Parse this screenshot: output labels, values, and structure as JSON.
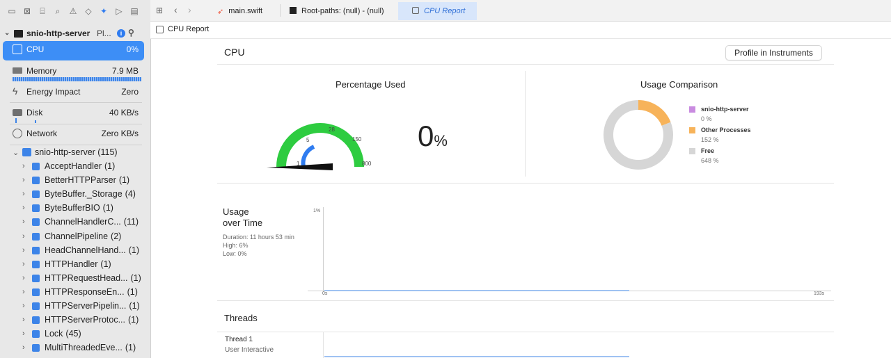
{
  "sidebar": {
    "process_name": "snio-http-server",
    "process_suffix": "Pl...",
    "gauges": [
      {
        "label": "CPU",
        "value": "0%"
      },
      {
        "label": "Memory",
        "value": "7.9 MB"
      },
      {
        "label": "Energy Impact",
        "value": "Zero"
      },
      {
        "label": "Disk",
        "value": "40 KB/s"
      },
      {
        "label": "Network",
        "value": "Zero KB/s"
      }
    ],
    "tree_root": {
      "label": "snio-http-server (115)"
    },
    "tree_items": [
      {
        "name": "AcceptHandler",
        "count": "(1)"
      },
      {
        "name": "BetterHTTPParser",
        "count": "(1)"
      },
      {
        "name": "ByteBuffer._Storage",
        "count": "(4)"
      },
      {
        "name": "ByteBufferBIO",
        "count": "(1)"
      },
      {
        "name": "ChannelHandlerC...",
        "count": "(11)"
      },
      {
        "name": "ChannelPipeline",
        "count": "(2)"
      },
      {
        "name": "HeadChannelHand...",
        "count": "(1)"
      },
      {
        "name": "HTTPHandler",
        "count": "(1)"
      },
      {
        "name": "HTTPRequestHead...",
        "count": "(1)"
      },
      {
        "name": "HTTPResponseEn...",
        "count": "(1)"
      },
      {
        "name": "HTTPServerPipelin...",
        "count": "(1)"
      },
      {
        "name": "HTTPServerProtoc...",
        "count": "(1)"
      },
      {
        "name": "Lock",
        "count": "(45)"
      },
      {
        "name": "MultiThreadedEve...",
        "count": "(1)"
      }
    ]
  },
  "tabs": [
    {
      "label": "main.swift"
    },
    {
      "label": "Root-paths: (null) - (null)"
    },
    {
      "label": "CPU Report"
    }
  ],
  "breadcrumb": "CPU Report",
  "report": {
    "title": "CPU",
    "profile_button": "Profile in Instruments",
    "percentage_used": {
      "title": "Percentage Used",
      "value": "0",
      "unit": "%",
      "gauge_labels": [
        "1",
        "5",
        "28",
        "150",
        "800"
      ]
    },
    "usage_comparison": {
      "title": "Usage Comparison",
      "items": [
        {
          "name": "snio-http-server",
          "value": "0 %",
          "color": "#c98be0",
          "percent": 0
        },
        {
          "name": "Other Processes",
          "value": "152 %",
          "color": "#f7b35a",
          "percent": 152
        },
        {
          "name": "Free",
          "value": "648 %",
          "color": "#d6d6d6",
          "percent": 648
        }
      ]
    },
    "usage_over_time": {
      "title_line1": "Usage",
      "title_line2": "over Time",
      "duration": "Duration: 11 hours 53 min",
      "high": "High: 6%",
      "low": "Low: 0%",
      "y_label": "1%",
      "x_start": "0s",
      "x_end": "193s"
    },
    "threads": {
      "title": "Threads",
      "items": [
        {
          "name": "Thread 1",
          "qos": "User Interactive"
        }
      ]
    }
  }
}
